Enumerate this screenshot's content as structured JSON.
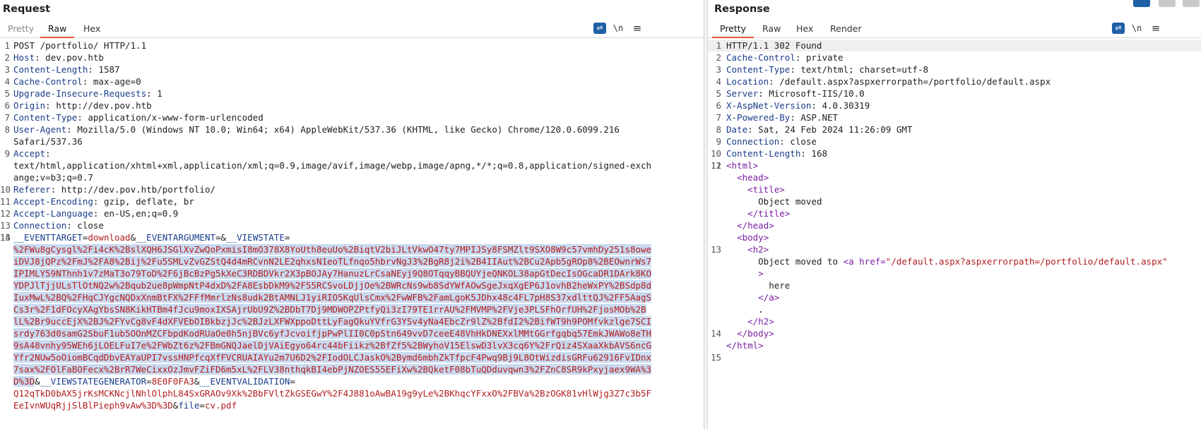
{
  "request": {
    "title": "Request",
    "tabs": [
      "Pretty",
      "Raw",
      "Hex"
    ],
    "active_tab": "Raw",
    "tools": {
      "wrap": "⇌",
      "newline": "\\n",
      "menu": "≡"
    },
    "lines": [
      {
        "n": "1",
        "text": "POST /portfolio/ HTTP/1.1"
      },
      {
        "n": "2",
        "name": "Host",
        "value": "dev.pov.htb"
      },
      {
        "n": "3",
        "name": "Content-Length",
        "value": "1587"
      },
      {
        "n": "4",
        "name": "Cache-Control",
        "value": "max-age=0"
      },
      {
        "n": "5",
        "name": "Upgrade-Insecure-Requests",
        "value": "1"
      },
      {
        "n": "6",
        "name": "Origin",
        "value": "http://dev.pov.htb"
      },
      {
        "n": "7",
        "name": "Content-Type",
        "value": "application/x-www-form-urlencoded"
      },
      {
        "n": "8",
        "name": "User-Agent",
        "value": "Mozilla/5.0 (Windows NT 10.0; Win64; x64) AppleWebKit/537.36 (KHTML, like Gecko) Chrome/120.0.6099.216",
        "cont": [
          "Safari/537.36"
        ]
      },
      {
        "n": "9",
        "name": "Accept",
        "value": "",
        "cont": [
          "text/html,application/xhtml+xml,application/xml;q=0.9,image/avif,image/webp,image/apng,*/*;q=0.8,application/signed-exch",
          "ange;v=b3;q=0.7"
        ]
      },
      {
        "n": "10",
        "name": "Referer",
        "value": "http://dev.pov.htb/portfolio/"
      },
      {
        "n": "11",
        "name": "Accept-Encoding",
        "value": "gzip, deflate, br"
      },
      {
        "n": "12",
        "name": "Accept-Language",
        "value": "en-US,en;q=0.9"
      },
      {
        "n": "13",
        "name": "Connection",
        "value": "close"
      },
      {
        "n": "14",
        "text": ""
      }
    ],
    "body_line_number": "15",
    "params": {
      "eventtarget_name": "__EVENTTARGET",
      "eventtarget_value": "download",
      "eventargument_name": "__EVENTARGUMENT",
      "eventargument_value": "",
      "viewstate_name": "__VIEWSTATE",
      "viewstate_lines": [
        "%2FWu8gCysgl%2Fi4cK%2BslXQH6JSGlXvZwQoPxmisI8mO378X8YoUth8euUo%2BiqtV2biJLtVkwO47ty7MPIJSy8FSMZlt9SXO8W9c57vmhDy251s8owe",
        "iDVJ8jQPz%2FmJ%2FA8%2Bij%2Fu5SMLvZvGZStQ4d4mRCvnN2LE2qhxsN1eoTLfnqo5hbrvNgJ3%2BgR8j2i%2B4IIAut%2BCu2Apb5gROp8%2BEOwnrWs7",
        "IPIMLY59NThnh1v7zMaT3o79ToD%2F6jBcBzPg5kXeC3RDBDVkr2X3pBOJAy7HanuzLrCsaNEyj9Q8OTqqyBBQUYjeQNKOL38apGtDecIsOGcaDR1DArk8KO",
        "YDPJlTjjULsTlOtNQ2w%2Bqub2ue8pWmpNtP4dxD%2FA8EsbDkM9%2F55RCSvoLDjjOe%2BWRcNs9wb8SdYWfAOwSgeJxqXgEP6J1ovhB2heWxPY%2BSdp8d",
        "IuxMwL%2BQ%2FHqCJYgcNQDxXnmBtFX%2FFfMmrlzNs8udk2BtAMNLJ1yiRIO5KqUlsCmx%2FwWFB%2FamLgoK5JDhx48c4FL7pH8S37xdlttQJ%2FF5AagS",
        "Cs3r%2F1dFOcyXAgYbsSN8KikHTBm4fJcu9moxIXSAjrUbU9Z%2BDbT7Dj9MDWOPZPtfyQi3zI79TE1rrAU%2FMVMP%2FVje3PLSFhOrfUH%2FjosMOb%2B",
        "lL%2Br9uccEjX%2BJ%2FYvCg8vF4dXFVEbOIBkbzjJc%2BJzLXFWXppoDttLyFagQkuYVfrG3YSv4yNa4EbcZr9lZ%2BfdI2%2BifWT9h9POMfvkzlge7SCI",
        "srdy763d0samG2SbuF1ub5OOnMZCFbpdKodRUaOe0h5njBVc6yfJcvoifjpPwPlII0C0pStn649vvD7ceeE48VhHkDNEXxlMMtGGrfgqbq57EmkJWAWo8eTH",
        "9sA48vnhy95WEh6jLOELFuI7e%2FWbZt6z%2FBmGNQJaelDjVAiEgyo64rc44bFiikz%2BfZf5%2BWyhoV15ElswD3lvX3cq6Y%2FrQiz4SXaaXkbAVS6ncG",
        "Yfr2NUw5oOiomBCqdDbvEAYaUPI7vssHNPfcqXfFVCRUAIAYu2m7U6D2%2FIodOLCJaskO%2Bymd6mbhZkTfpcF4Pwq9Bj9L8OtWizdisGRFu62916FvIDnx",
        "7sax%2FOlFaBOFecx%2BrR7WeCixxOzJmvFZiFD6m5xL%2FLV38nthqkBI4ebPjNZOES55EFiXw%2BQketF08bTuQDduvqwn3%2FZnC8SR9kPxyjaex9WA%3",
        "D%3D"
      ],
      "viewstategen_name": "__VIEWSTATEGENERATOR",
      "viewstategen_value": "8E0F0FA3",
      "eventvalidation_name": "__EVENTVALIDATION",
      "eventvalidation_lines": [
        "Q12qTkD0bAX5jrKsMCKNcjlNhlOlphL84SxGRAOv9Xk%2BbFVltZkGSEGwY%2F4J881oAwBA19g9yLe%2BKhqcYFxxO%2FBVa%2BzOGK81vHlWjg3Z7c3b5F",
        "EeIvnWUqRjjSlBlPieph9vAw%3D%3D"
      ],
      "file_name": "file",
      "file_value": "cv.pdf"
    }
  },
  "response": {
    "title": "Response",
    "tabs": [
      "Pretty",
      "Raw",
      "Hex",
      "Render"
    ],
    "active_tab": "Pretty",
    "tools": {
      "wrap": "⇌",
      "newline": "\\n",
      "menu": "≡"
    },
    "lines": [
      {
        "n": "1",
        "text": "HTTP/1.1 302 Found"
      },
      {
        "n": "2",
        "name": "Cache-Control",
        "value": "private"
      },
      {
        "n": "3",
        "name": "Content-Type",
        "value": "text/html; charset=utf-8"
      },
      {
        "n": "4",
        "name": "Location",
        "value": "/default.aspx?aspxerrorpath=/portfolio/default.aspx"
      },
      {
        "n": "5",
        "name": "Server",
        "value": "Microsoft-IIS/10.0"
      },
      {
        "n": "6",
        "name": "X-AspNet-Version",
        "value": "4.0.30319"
      },
      {
        "n": "7",
        "name": "X-Powered-By",
        "value": "ASP.NET"
      },
      {
        "n": "8",
        "name": "Date",
        "value": "Sat, 24 Feb 2024 11:26:09 GMT"
      },
      {
        "n": "9",
        "name": "Connection",
        "value": "close"
      },
      {
        "n": "10",
        "name": "Content-Length",
        "value": "168"
      },
      {
        "n": "11",
        "text": ""
      }
    ],
    "html_lines": [
      {
        "n": "12",
        "indent": "",
        "tag": "<html>"
      },
      {
        "n": "",
        "indent": "  ",
        "tag": "<head>"
      },
      {
        "n": "",
        "indent": "    ",
        "tag": "<title>"
      },
      {
        "n": "",
        "indent": "      ",
        "text": "Object moved"
      },
      {
        "n": "",
        "indent": "    ",
        "tag": "</title>"
      },
      {
        "n": "",
        "indent": "  ",
        "tag": "</head>"
      },
      {
        "n": "",
        "indent": "  ",
        "tag": "<body>"
      },
      {
        "n": "13",
        "indent": "    ",
        "tag": "<h2>"
      },
      {
        "n": "",
        "indent": "      ",
        "text": "Object moved to ",
        "tag": "<a href=",
        "attr": "\"/default.aspx?aspxerrorpath=/portfolio/default.aspx\""
      },
      {
        "n": "",
        "indent": "      ",
        "tag": ">"
      },
      {
        "n": "",
        "indent": "        ",
        "text": "here"
      },
      {
        "n": "",
        "indent": "      ",
        "tag": "</a>"
      },
      {
        "n": "",
        "indent": "      ",
        "text": "."
      },
      {
        "n": "",
        "indent": "    ",
        "tag": "</h2>"
      },
      {
        "n": "14",
        "indent": "  ",
        "tag": "</body>"
      },
      {
        "n": "",
        "indent": "",
        "tag": "</html>"
      },
      {
        "n": "15",
        "indent": "",
        "text": ""
      }
    ]
  },
  "colors": {
    "accent_tab_underline": "#e8562a",
    "header_name": "#1a3e8a",
    "param_value": "#b21d1d",
    "selection": "#c8daf0",
    "html_tag": "#7b1fa2",
    "view_icon_active": "#1f5fa6"
  }
}
